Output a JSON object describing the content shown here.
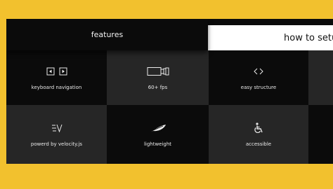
{
  "tabs": {
    "features": "features",
    "setup": "how to setup"
  },
  "features": [
    {
      "label": "keyboard navigation",
      "icon": "keyboard-arrows-icon"
    },
    {
      "label": "60+ fps",
      "icon": "film-camera-icon"
    },
    {
      "label": "easy structure",
      "icon": "code-brackets-icon"
    },
    {
      "label": "powerd by velocity.js",
      "icon": "velocity-logo-icon"
    },
    {
      "label": "lightweight",
      "icon": "feather-icon"
    },
    {
      "label": "accessible",
      "icon": "wheelchair-icon"
    }
  ],
  "colors": {
    "background": "#f2c12e",
    "panel": "#0b0b0b",
    "cell_alt": "#262626",
    "text": "#eaeaea"
  }
}
